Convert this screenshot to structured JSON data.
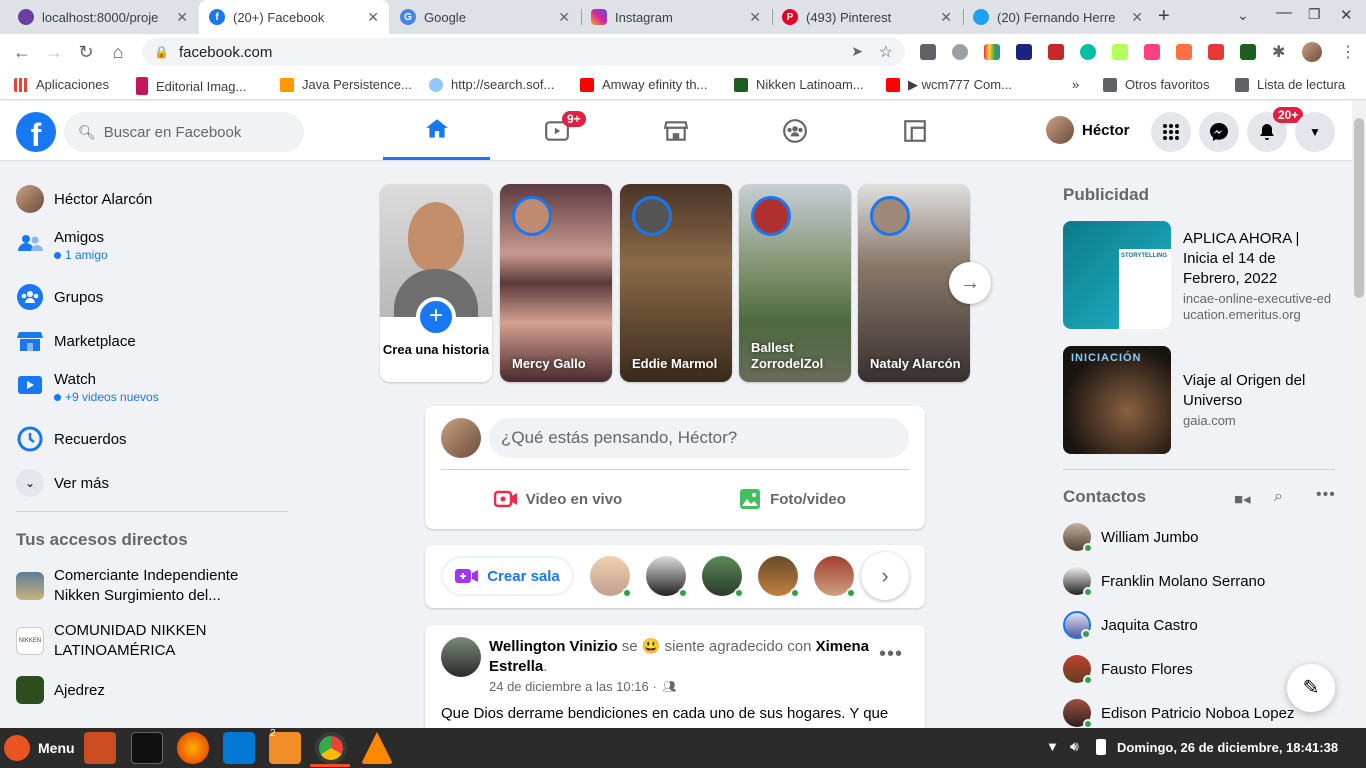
{
  "browser": {
    "tabs": [
      {
        "title": "localhost:8000/proje",
        "color": "#6a3fa0"
      },
      {
        "title": "(20+) Facebook",
        "color": "#1877f2"
      },
      {
        "title": "Google",
        "color": "#4285f4"
      },
      {
        "title": "Instagram",
        "color": "#d6249f"
      },
      {
        "title": "(493) Pinterest",
        "color": "#e60023"
      },
      {
        "title": "(20) Fernando Herre",
        "color": "#1da1f2"
      }
    ],
    "url": "facebook.com",
    "bookmarks": [
      "Aplicaciones",
      "Editorial Imag...",
      "Java Persistence...",
      "http://search.sof...",
      "Amway efinity th...",
      "Nikken Latinoam...",
      "▶ wcm777 Com..."
    ],
    "bookmarks_right": [
      "Otros favoritos",
      "Lista de lectura"
    ]
  },
  "fb": {
    "logo": "f",
    "search_placeholder": "Buscar en Facebook",
    "watch_badge": "9+",
    "notif_badge": "20+",
    "user_short": "Héctor"
  },
  "left": {
    "items": [
      {
        "label": "Héctor Alarcón"
      },
      {
        "label": "Amigos",
        "sub": "1 amigo"
      },
      {
        "label": "Grupos"
      },
      {
        "label": "Marketplace"
      },
      {
        "label": "Watch",
        "sub": "+9 videos nuevos"
      },
      {
        "label": "Recuerdos"
      },
      {
        "label": "Ver más"
      }
    ],
    "shortcuts_title": "Tus accesos directos",
    "shortcuts": [
      {
        "label": "Comerciante Independiente Nikken Surgimiento del..."
      },
      {
        "label": "COMUNIDAD NIKKEN LATINOAMÉRICA"
      },
      {
        "label": "Ajedrez"
      }
    ]
  },
  "stories": {
    "create_label": "Crea una historia",
    "items": [
      "Mercy Gallo",
      "Eddie Marmol",
      "Ballest ZorrodelZol",
      "Nataly Alarcón"
    ]
  },
  "composer": {
    "placeholder": "¿Qué estás pensando, Héctor?",
    "live": "Video en vivo",
    "photo": "Foto/video"
  },
  "rooms": {
    "label": "Crear sala"
  },
  "post": {
    "author": "Wellington Vinizio",
    "feeling_pre": "se",
    "feeling_emoji": "😃",
    "feeling_text": "siente agradecido con",
    "tagged": "Ximena Estrella",
    "date": "24 de diciembre a las 10:16 ·",
    "text": "Que Dios derrame bendiciones en cada uno de sus hogares. Y que"
  },
  "right": {
    "ads_title": "Publicidad",
    "ads": [
      {
        "title": "APLICA AHORA | Inicia el 14 de Febrero, 2022",
        "domain": "incae-online-executive-education.emeritus.org",
        "img_text": "STORYTELLING"
      },
      {
        "title": "Viaje al Origen del Universo",
        "domain": "gaia.com",
        "img_text": "INICIACIÓN"
      }
    ],
    "contacts_title": "Contactos",
    "contacts": [
      "William Jumbo",
      "Franklin Molano Serrano",
      "Jaquita Castro",
      "Fausto Flores",
      "Edison Patricio Noboa Lopez"
    ]
  },
  "taskbar": {
    "menu": "Menu",
    "folder_count": "2",
    "clock": "Domingo, 26 de diciembre, 18:41:38"
  }
}
